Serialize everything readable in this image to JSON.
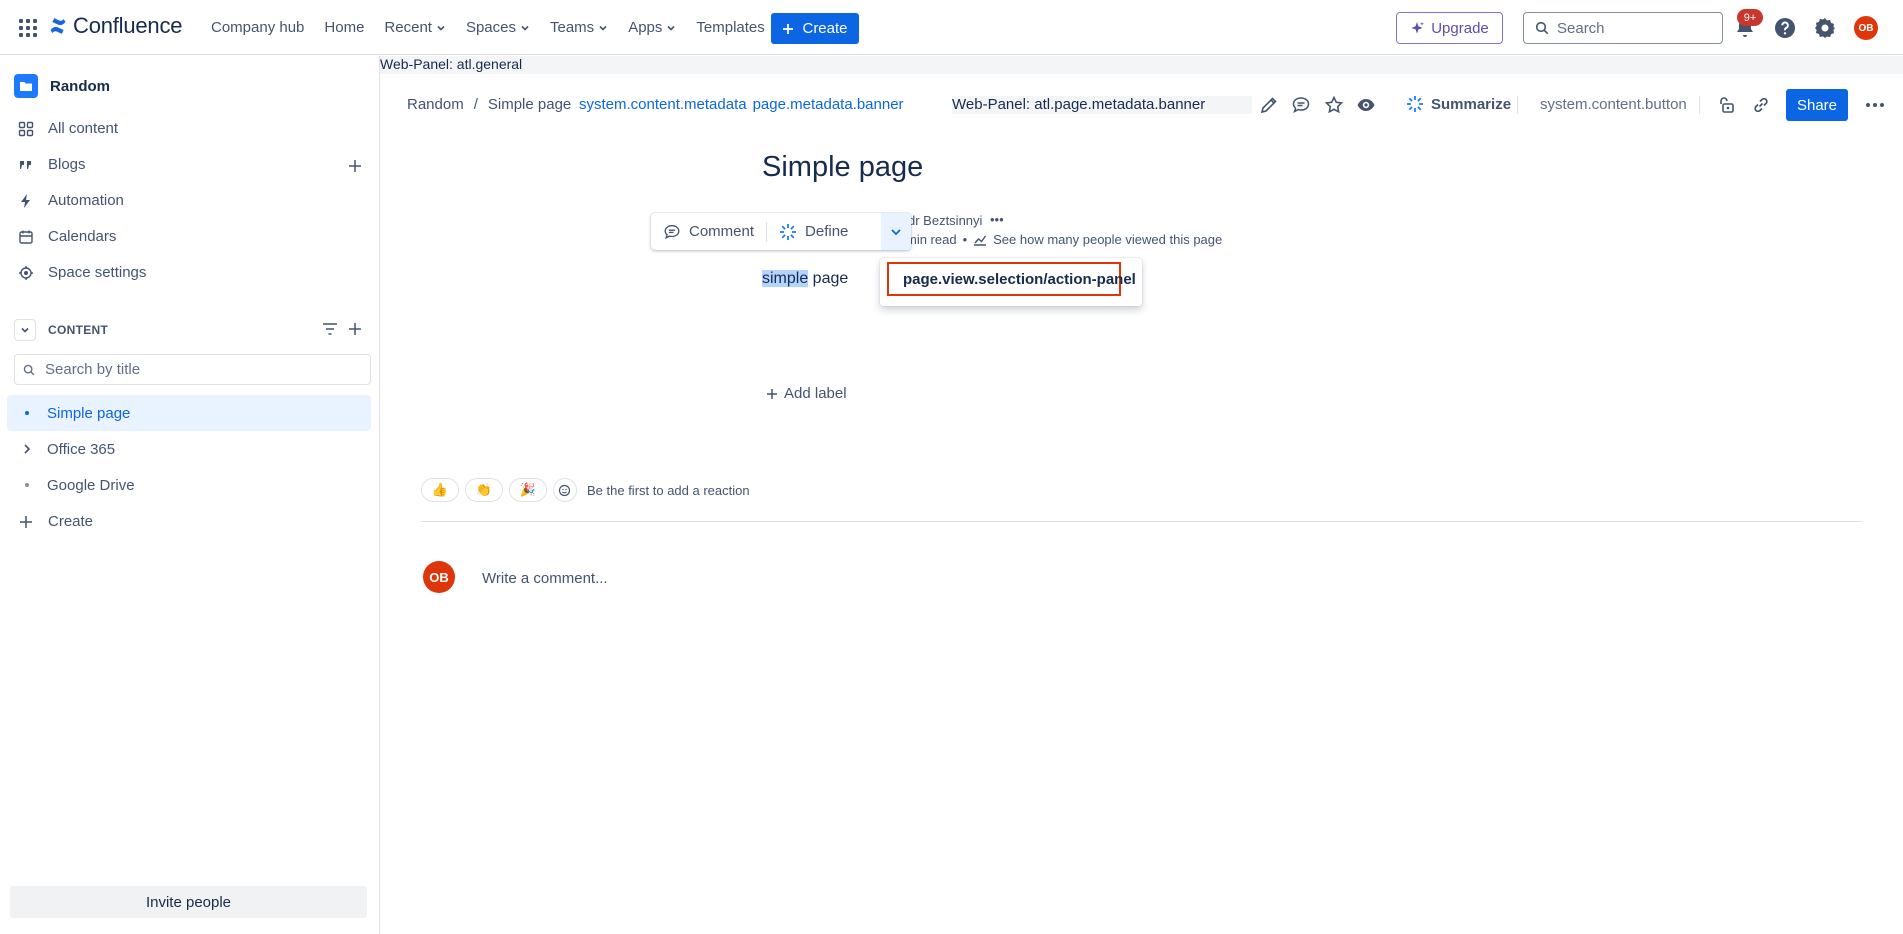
{
  "topnav": {
    "brand": "Confluence",
    "links": [
      {
        "label": "Company hub",
        "dropdown": false
      },
      {
        "label": "Home",
        "dropdown": false
      },
      {
        "label": "Recent",
        "dropdown": true
      },
      {
        "label": "Spaces",
        "dropdown": true
      },
      {
        "label": "Teams",
        "dropdown": true
      },
      {
        "label": "Apps",
        "dropdown": true
      },
      {
        "label": "Templates",
        "dropdown": false
      }
    ],
    "create_label": "Create",
    "upgrade_label": "Upgrade",
    "search_placeholder": "Search",
    "notification_count": "9+",
    "avatar_initials": "OB",
    "icons": [
      "app-switcher-icon",
      "confluence-logo-icon",
      "notifications-icon",
      "help-icon",
      "settings-icon"
    ]
  },
  "sidebar": {
    "space_name": "Random",
    "items": [
      {
        "label": "All content",
        "icon": "all-content-icon"
      },
      {
        "label": "Blogs",
        "icon": "quote-icon"
      },
      {
        "label": "Automation",
        "icon": "lightning-icon"
      },
      {
        "label": "Calendars",
        "icon": "calendar-icon"
      },
      {
        "label": "Space settings",
        "icon": "gear-icon"
      }
    ],
    "content_header": "CONTENT",
    "search_placeholder": "Search by title",
    "tree": [
      {
        "label": "Simple page",
        "active": true,
        "expandable": false
      },
      {
        "label": "Office 365",
        "active": false,
        "expandable": true
      },
      {
        "label": "Google Drive",
        "active": false,
        "expandable": false
      }
    ],
    "create_label": "Create",
    "invite_label": "Invite people"
  },
  "main": {
    "web_panel_general": "Web-Panel: atl.general",
    "breadcrumb": [
      "Random",
      "Simple page"
    ],
    "breadcrumb_separator": "/",
    "meta_links": [
      "system.content.metadata",
      "page.metadata.banner"
    ],
    "banner_panel": "Web-Panel: atl.page.metadata.banner",
    "summarize_label": "Summarize",
    "content_button": "system.content.button",
    "share_label": "Share",
    "page_title": "Simple page",
    "byline_author_partial": "dr Beztsinnyi",
    "read_time_partial": "min read",
    "views_link": "See how many people viewed this page",
    "body_highlight": "simple",
    "body_rest": " page",
    "selection_toolbar": {
      "comment": "Comment",
      "define": "Define"
    },
    "action_panel_item": "page.view.selection/action-panel",
    "add_label": "Add label",
    "reactions": [
      "👍",
      "👏",
      "🎉"
    ],
    "reaction_prompt": "Be the first to add a reaction",
    "comment_avatar": "OB",
    "comment_placeholder": "Write a comment..."
  },
  "colors": {
    "primary": "#0c66e4",
    "upgrade_border": "#8270db",
    "avatar": "#de350b",
    "highlight_border": "#de350b",
    "selection_highlight": "#b3d4ff",
    "active_tree_bg": "#e9f2ff"
  }
}
